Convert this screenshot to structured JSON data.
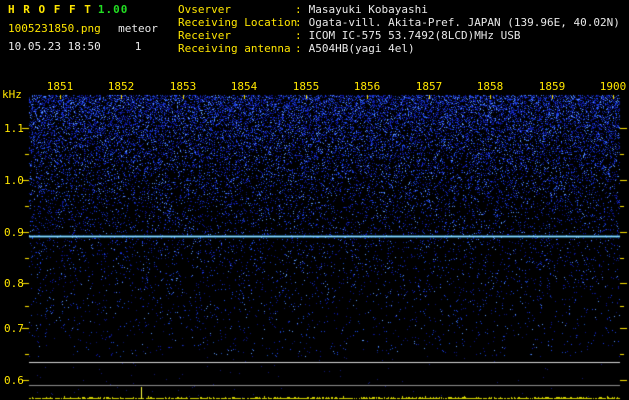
{
  "header": {
    "app_title": "H R O F F T",
    "version": "1.00",
    "filename": "1005231850.png",
    "mode": "meteor",
    "datetime": "10.05.23 18:50",
    "sequence": "1",
    "sep": ":",
    "info": [
      {
        "label": "Ovserver",
        "value": "Masayuki Kobayashi"
      },
      {
        "label": "Receiving Location",
        "value": "Ogata-vill. Akita-Pref. JAPAN (139.96E, 40.02N)"
      },
      {
        "label": "Receiver",
        "value": "ICOM IC-575 53.7492(8LCD)MHz USB"
      },
      {
        "label": "Receiving antenna",
        "value": "A504HB(yagi 4el)"
      }
    ]
  },
  "chart_data": {
    "type": "heatmap",
    "title": "HROFFT 10-minute meteor-echo spectrogram 18:51-19:00",
    "x_ticks": [
      "1851",
      "1852",
      "1853",
      "1854",
      "1855",
      "1856",
      "1857",
      "1858",
      "1859",
      "1900"
    ],
    "xlabel": "",
    "ylabel": "kHz",
    "y_ticks": [
      "1.1",
      "1.0",
      "0.9",
      "0.8",
      "0.7",
      "0.6"
    ],
    "ylim": [
      0.55,
      1.15
    ],
    "carrier_line_khz": 0.9,
    "noise_profile": "blue random noise, dense near top (1.1 kHz) fading to black below 0.7 kHz",
    "level_band": {
      "reference_lines": 2,
      "trace": "flat yellow baseline with minor fluctuation",
      "spike_x_fraction": 0.19
    },
    "grid": false,
    "legend": false
  },
  "colors": {
    "background": "#000000",
    "axis_text": "#ffe600",
    "version_text": "#22dd22",
    "value_text": "#e8e8e8",
    "noise_blue": "#1e3cc8",
    "carrier_cyan": "#8fe0ff",
    "reference_line": "#d8d8d8",
    "trace_yellow": "#d6d600"
  }
}
